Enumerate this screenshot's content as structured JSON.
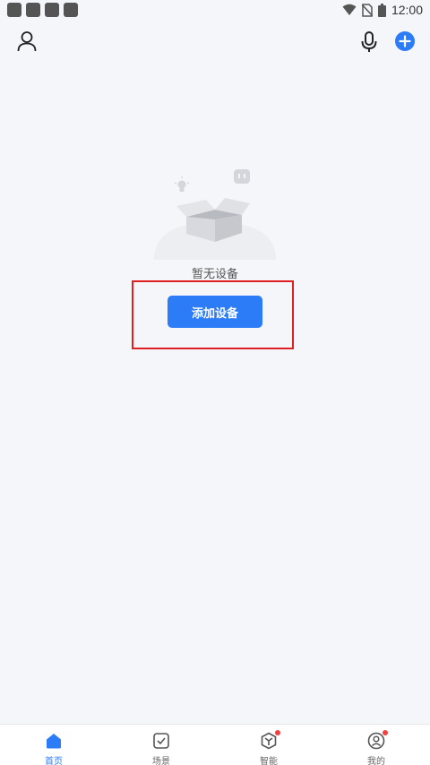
{
  "status_bar": {
    "time": "12:00"
  },
  "main": {
    "empty_text": "暂无设备",
    "add_device_label": "添加设备"
  },
  "tabbar": {
    "tabs": [
      {
        "label": "首页",
        "active": true
      },
      {
        "label": "场景",
        "active": false
      },
      {
        "label": "智能",
        "active": false
      },
      {
        "label": "我的",
        "active": false
      }
    ]
  },
  "colors": {
    "accent": "#2b7cf6",
    "badge": "#f04040",
    "highlight": "#e02020"
  }
}
